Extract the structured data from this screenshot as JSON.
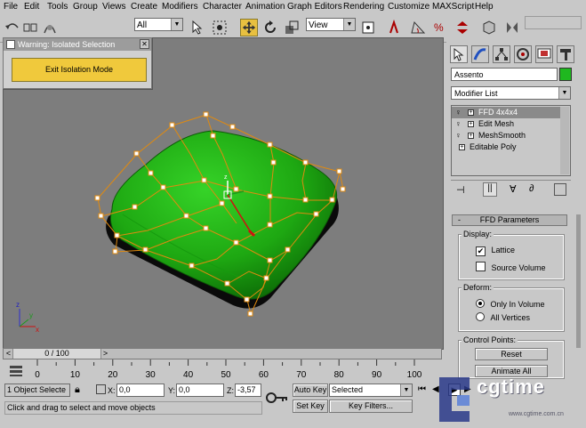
{
  "menu": [
    "File",
    "Edit",
    "Tools",
    "Group",
    "Views",
    "Create",
    "Modifiers",
    "Character",
    "Animation",
    "Graph Editors",
    "Rendering",
    "Customize",
    "MAXScript",
    "Help"
  ],
  "toolbar": {
    "selection_filter": "All",
    "ref_coord": "View"
  },
  "warning_dialog": {
    "title": "Warning: Isolated Selection",
    "close": "✕",
    "button": "Exit Isolation Mode"
  },
  "viewport": {
    "object_color": "#22b014",
    "lattice_color": "#e08a10",
    "axis_z": "z",
    "axis_y": "y",
    "axis_x": "x"
  },
  "panel": {
    "object_name": "Assento",
    "object_color": "#1fb81f",
    "modifier_list_label": "Modifier List",
    "stack": [
      {
        "label": "FFD 4x4x4",
        "selected": true
      },
      {
        "label": "Edit Mesh",
        "selected": false
      },
      {
        "label": "MeshSmooth",
        "selected": false
      },
      {
        "label": "Editable Poly",
        "selected": false
      }
    ],
    "rollout_title": "FFD Parameters",
    "rollout_toggle": "-",
    "display_label": "Display:",
    "lattice_label": "Lattice",
    "lattice_checked": true,
    "source_volume_label": "Source Volume",
    "source_volume_checked": false,
    "deform_label": "Deform:",
    "only_in_volume_label": "Only In Volume",
    "all_vertices_label": "All Vertices",
    "deform_selected": "Only In Volume",
    "control_points_label": "Control Points:",
    "reset_label": "Reset",
    "animate_all_label": "Animate All"
  },
  "timeline": {
    "frame_readout": "0 / 100",
    "ticks": [
      "0",
      "10",
      "20",
      "30",
      "40",
      "50",
      "60",
      "70",
      "80",
      "90",
      "100"
    ],
    "prev": "<",
    "next": ">"
  },
  "status": {
    "selection_count": "1 Object Selecte",
    "x_label": "X:",
    "x_value": "0,0",
    "y_label": "Y:",
    "y_value": "0,0",
    "z_label": "Z:",
    "z_value": "-3,57",
    "auto_key": "Auto Key",
    "set_key": "Set Key",
    "key_mode": "Selected",
    "key_filters": "Key Filters...",
    "prompt": "Click and drag to select and move objects"
  },
  "watermark": {
    "text": "cgtime",
    "sub": "www.cgtime.com.cn"
  }
}
